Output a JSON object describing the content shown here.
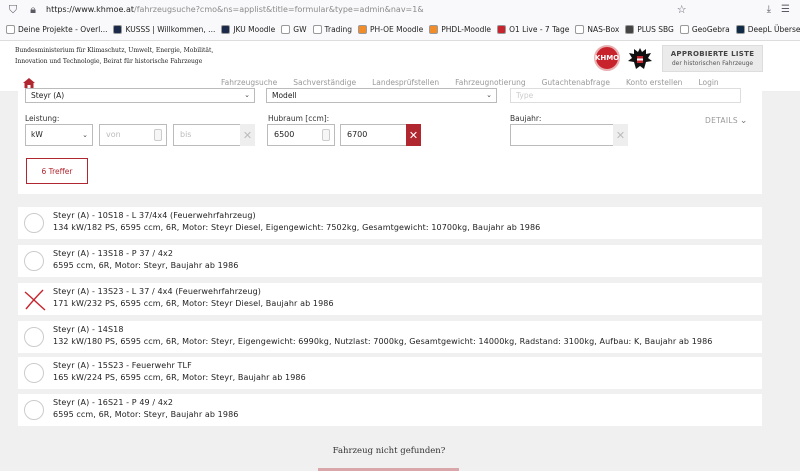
{
  "browser": {
    "url_host": "https://www.khmoe.at",
    "url_rest": "/fahrzeugsuche?cmo&ns=applist&title=formular&type=admin&nav=1&",
    "bookmarks": [
      {
        "label": "Deine Projekte - Overl...",
        "color": "#ffffff"
      },
      {
        "label": "KUSSS | Willkommen, ...",
        "color": "#1b2a4a"
      },
      {
        "label": "JKU Moodle",
        "color": "#1b2a4a"
      },
      {
        "label": "GW",
        "color": "#ffffff"
      },
      {
        "label": "Trading",
        "color": "#ffffff"
      },
      {
        "label": "PH-OE Moodle",
        "color": "#f28c28"
      },
      {
        "label": "PHDL-Moodle",
        "color": "#f28c28"
      },
      {
        "label": "O1 Live - 7 Tage",
        "color": "#c8232c"
      },
      {
        "label": "NAS-Box",
        "color": "#ffffff"
      },
      {
        "label": "PLUS SBG",
        "color": "#444444"
      },
      {
        "label": "GeoGebra",
        "color": "#ffffff"
      },
      {
        "label": "DeepL Übersetzer - De...",
        "color": "#0f2b46"
      }
    ],
    "overflow": "»"
  },
  "header": {
    "ministry_lines": [
      "Bundesministerium für Klimaschutz, Umwelt, Energie, Mobilität,",
      "Innovation und Technologie, Beirat für historische Fahrzeuge"
    ],
    "logo_text": "KHMO",
    "historic_title": "APPROBIERTE LISTE",
    "historic_sub": "der historischen Fahrzeuge"
  },
  "nav": {
    "items": [
      "Fahrzeugsuche",
      "Sachverständige",
      "Landesprüfstellen",
      "Fahrzeugnotierung",
      "Gutachtenabfrage",
      "Konto erstellen",
      "Login"
    ]
  },
  "form": {
    "make_value": "Steyr (A)",
    "model_value": "Modell",
    "type_placeholder": "Type",
    "leistung_label": "Leistung:",
    "leistung_unit": "kW",
    "von_placeholder": "von",
    "bis_placeholder": "bis",
    "hubraum_label": "Hubraum [ccm]:",
    "hubraum_from": "6500",
    "hubraum_to": "6700",
    "baujahr_label": "Baujahr:",
    "details_label": "DETAILS",
    "treffer_label": "6 Treffer"
  },
  "results": [
    {
      "title": "Steyr (A) - 10S18 - L 37/4x4 (Feuerwehrfahrzeug)",
      "desc": "134 kW/182 PS, 6595 ccm, 6R, Motor: Steyr Diesel, Eigengewicht: 7502kg, Gesamtgewicht: 10700kg, Baujahr ab 1986",
      "marked": false
    },
    {
      "title": "Steyr (A) - 13S18 - P 37 / 4x2",
      "desc": "6595 ccm, 6R, Motor: Steyr, Baujahr ab 1986",
      "marked": false
    },
    {
      "title": "Steyr (A) - 13S23 - L 37 / 4x4 (Feuerwehrfahrzeug)",
      "desc": "171 kW/232 PS, 6595 ccm, 6R, Motor: Steyr Diesel, Baujahr ab 1986",
      "marked": true
    },
    {
      "title": "Steyr (A) - 14S18",
      "desc": "132 kW/180 PS, 6595 ccm, 6R, Motor: Steyr, Eigengewicht: 6990kg, Nutzlast: 7000kg, Gesamtgewicht: 14000kg, Radstand: 3100kg, Aufbau: K, Baujahr ab 1986",
      "marked": false
    },
    {
      "title": "Steyr (A) - 15S23 - Feuerwehr TLF",
      "desc": "165 kW/224 PS, 6595 ccm, 6R, Motor: Steyr, Baujahr ab 1986",
      "marked": false
    },
    {
      "title": "Steyr (A) - 16S21 - P 49 / 4x2",
      "desc": "6595 ccm, 6R, Motor: Steyr, Baujahr ab 1986",
      "marked": false
    }
  ],
  "footer": {
    "not_found": "Fahrzeug nicht gefunden?"
  },
  "colors": {
    "accent": "#b0272f",
    "logo_red": "#c8232c"
  }
}
